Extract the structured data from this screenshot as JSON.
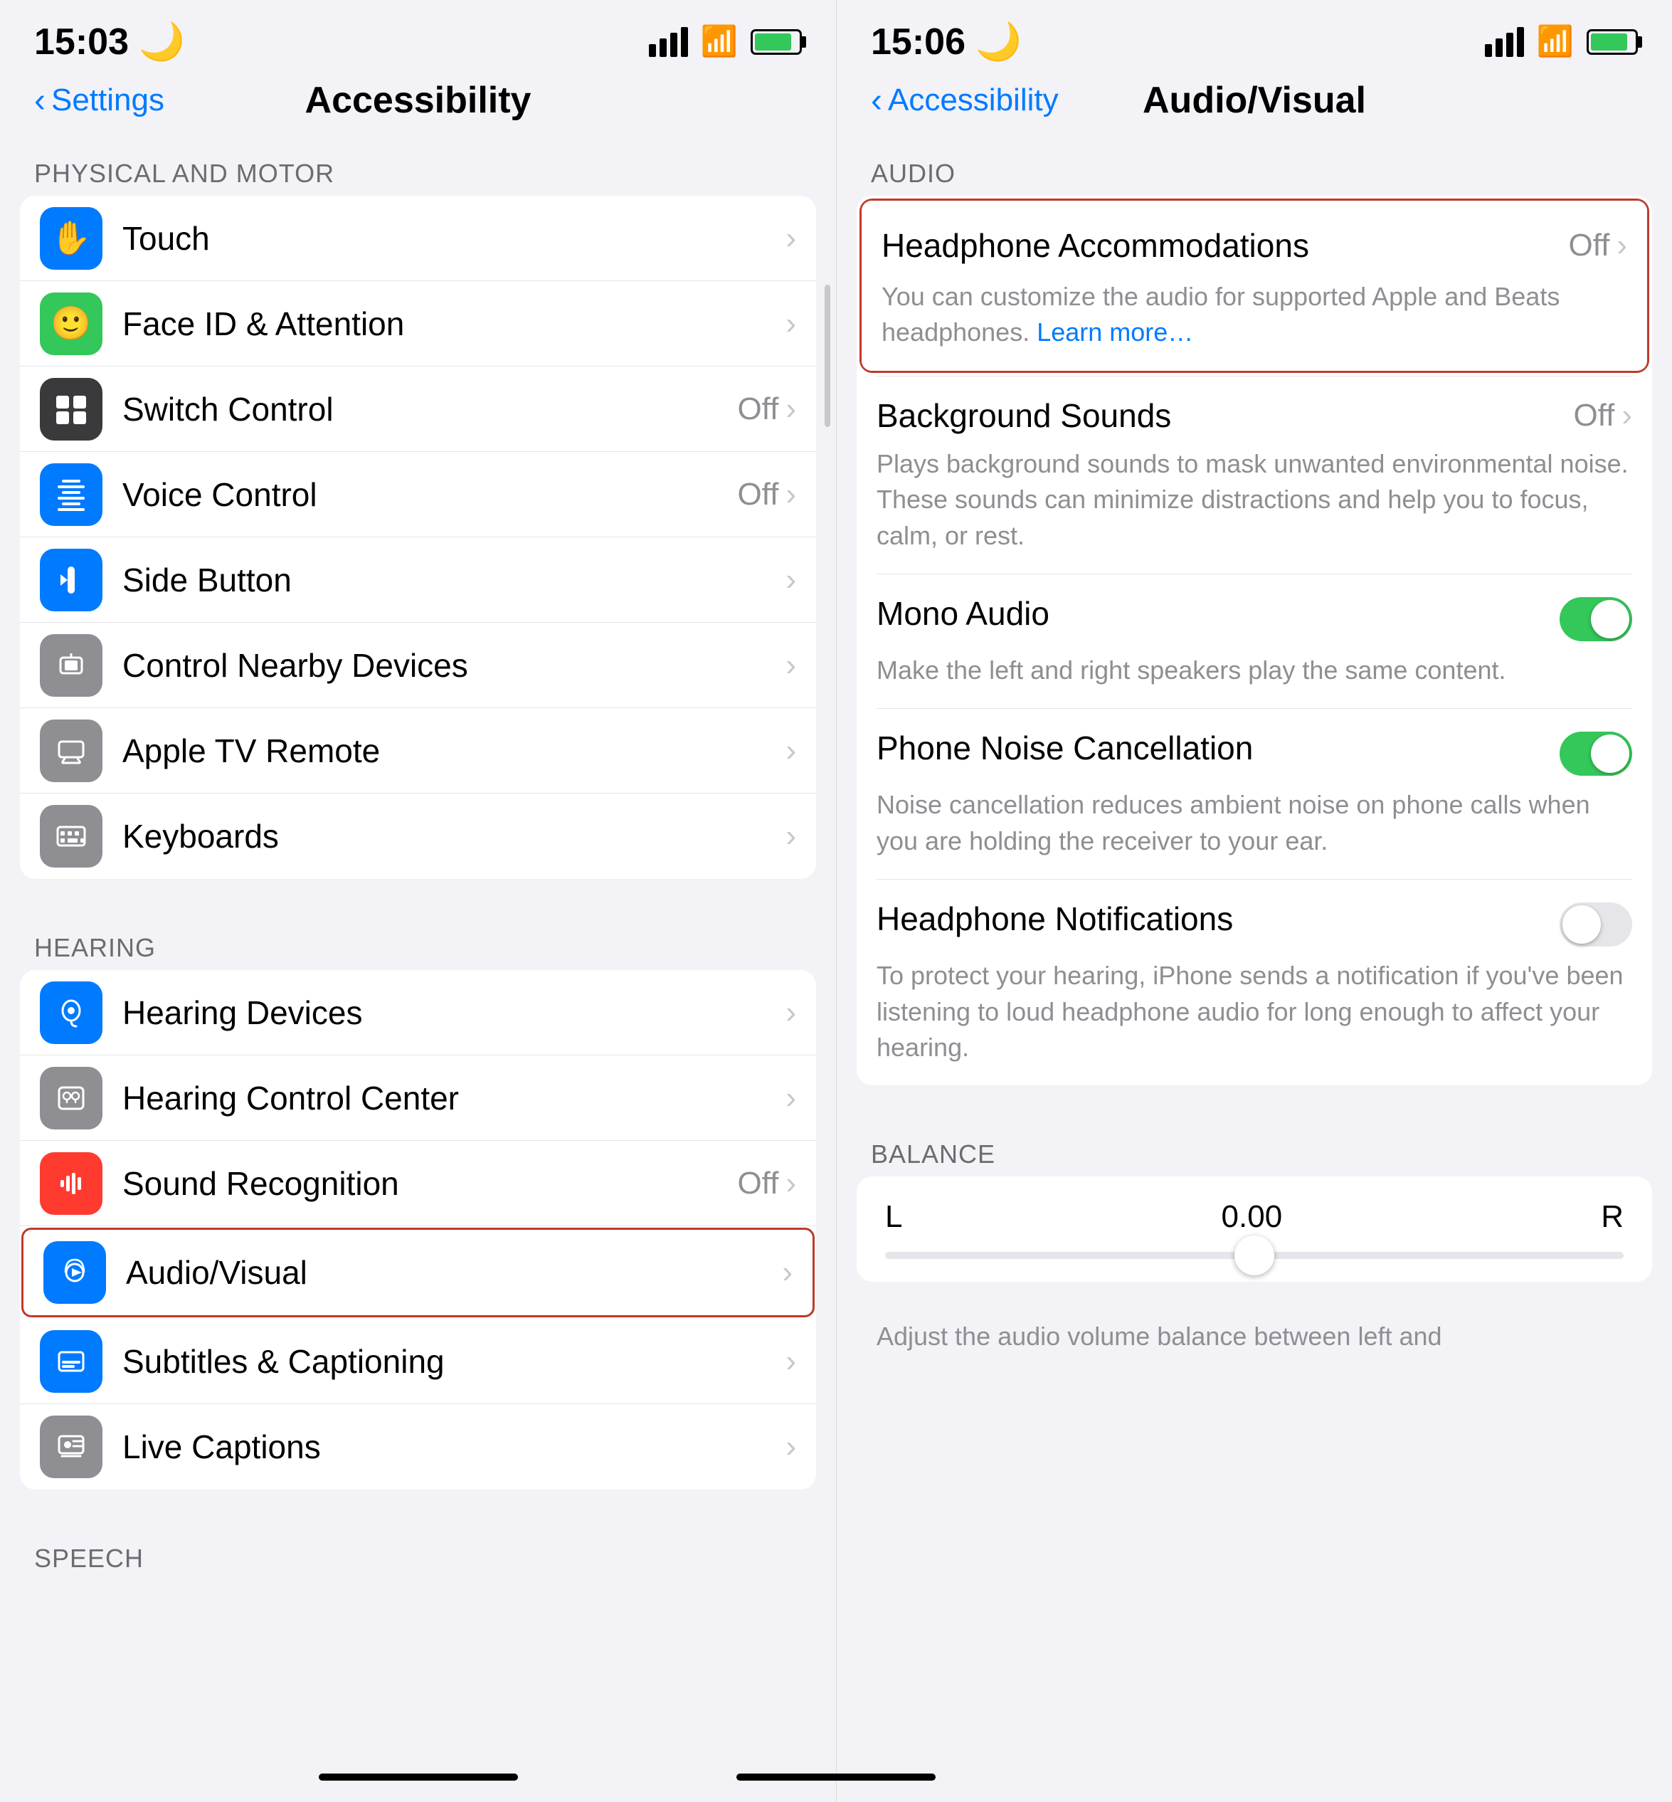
{
  "left_panel": {
    "status": {
      "time": "15:03",
      "moon": "🌙"
    },
    "nav": {
      "back_label": "Settings",
      "title": "Accessibility"
    },
    "sections": [
      {
        "header": "PHYSICAL AND MOTOR",
        "items": [
          {
            "id": "touch",
            "label": "Touch",
            "icon_color": "bg-blue",
            "icon": "touch",
            "value": "",
            "chevron": true
          },
          {
            "id": "faceid",
            "label": "Face ID & Attention",
            "icon_color": "bg-green",
            "icon": "faceid",
            "value": "",
            "chevron": true
          },
          {
            "id": "switch-control",
            "label": "Switch Control",
            "icon_color": "bg-dark",
            "icon": "switch",
            "value": "Off",
            "chevron": true
          },
          {
            "id": "voice-control",
            "label": "Voice Control",
            "icon_color": "bg-blue",
            "icon": "voice",
            "value": "Off",
            "chevron": true
          },
          {
            "id": "side-button",
            "label": "Side Button",
            "icon_color": "bg-blue",
            "icon": "side",
            "value": "",
            "chevron": true
          },
          {
            "id": "control-nearby",
            "label": "Control Nearby Devices",
            "icon_color": "bg-gray",
            "icon": "control",
            "value": "",
            "chevron": true
          },
          {
            "id": "apple-tv-remote",
            "label": "Apple TV Remote",
            "icon_color": "bg-gray",
            "icon": "tv",
            "value": "",
            "chevron": true
          },
          {
            "id": "keyboards",
            "label": "Keyboards",
            "icon_color": "bg-gray",
            "icon": "keyboard",
            "value": "",
            "chevron": true
          }
        ]
      },
      {
        "header": "HEARING",
        "items": [
          {
            "id": "hearing-devices",
            "label": "Hearing Devices",
            "icon_color": "bg-blue",
            "icon": "hearing",
            "value": "",
            "chevron": true
          },
          {
            "id": "hearing-control-center",
            "label": "Hearing Control Center",
            "icon_color": "bg-gray",
            "icon": "hcc",
            "value": "",
            "chevron": true
          },
          {
            "id": "sound-recognition",
            "label": "Sound Recognition",
            "icon_color": "bg-red",
            "icon": "sound",
            "value": "Off",
            "chevron": true
          },
          {
            "id": "audio-visual",
            "label": "Audio/Visual",
            "icon_color": "bg-blue",
            "icon": "audio",
            "value": "",
            "chevron": true,
            "highlighted": true
          },
          {
            "id": "subtitles-captioning",
            "label": "Subtitles & Captioning",
            "icon_color": "bg-blue",
            "icon": "subtitles",
            "value": "",
            "chevron": true
          },
          {
            "id": "live-captions",
            "label": "Live Captions",
            "icon_color": "bg-gray",
            "icon": "captions",
            "value": "",
            "chevron": true
          }
        ]
      },
      {
        "header": "SPEECH",
        "items": []
      }
    ]
  },
  "right_panel": {
    "status": {
      "time": "15:06",
      "moon": "🌙"
    },
    "nav": {
      "back_label": "Accessibility",
      "title": "Audio/Visual"
    },
    "section_audio_header": "AUDIO",
    "items": [
      {
        "id": "headphone-accommodations",
        "label": "Headphone Accommodations",
        "value": "Off",
        "chevron": true,
        "sub": "You can customize the audio for supported Apple and Beats headphones.",
        "sub_link": "Learn more…",
        "highlighted": true,
        "type": "value"
      },
      {
        "id": "background-sounds",
        "label": "Background Sounds",
        "value": "Off",
        "chevron": true,
        "sub": "Plays background sounds to mask unwanted environmental noise. These sounds can minimize distractions and help you to focus, calm, or rest.",
        "type": "value"
      },
      {
        "id": "mono-audio",
        "label": "Mono Audio",
        "toggle": "on",
        "sub": "Make the left and right speakers play the same content.",
        "type": "toggle"
      },
      {
        "id": "phone-noise-cancellation",
        "label": "Phone Noise Cancellation",
        "toggle": "on",
        "sub": "Noise cancellation reduces ambient noise on phone calls when you are holding the receiver to your ear.",
        "type": "toggle"
      },
      {
        "id": "headphone-notifications",
        "label": "Headphone Notifications",
        "toggle": "off",
        "sub": "To protect your hearing, iPhone sends a notification if you've been listening to loud headphone audio for long enough to affect your hearing.",
        "type": "toggle"
      }
    ],
    "balance_section": {
      "header": "BALANCE",
      "left_label": "L",
      "right_label": "R",
      "value": "0.00",
      "sub": "Adjust the audio volume balance between left and"
    }
  }
}
